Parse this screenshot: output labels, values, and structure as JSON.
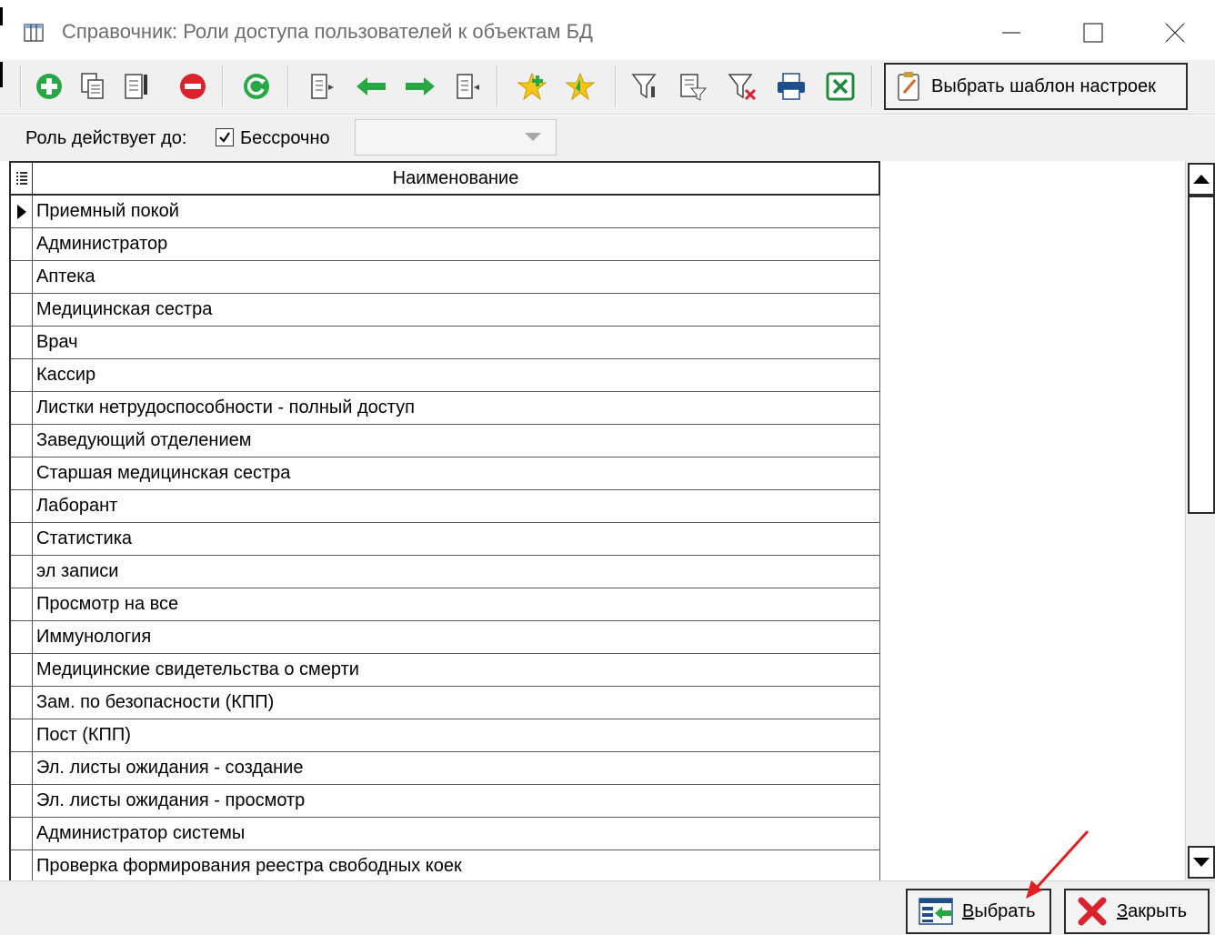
{
  "window": {
    "title": "Справочник: Роли доступа пользователей к объектам БД"
  },
  "toolbar": {
    "icons": [
      "add-icon",
      "copy-icon",
      "edit-icon",
      "delete-icon",
      "refresh-icon",
      "move-left-list-icon",
      "arrow-left-icon",
      "arrow-right-icon",
      "move-right-list-icon",
      "favorite-add-icon",
      "favorite-icon",
      "filter-icon",
      "filter-edit-icon",
      "filter-clear-icon",
      "print-icon",
      "excel-export-icon",
      "template-icon"
    ],
    "template_button_label": "Выбрать шаблон настроек"
  },
  "filter": {
    "role_valid_until_label": "Роль действует до:",
    "indefinite_label": "Бессрочно",
    "indefinite_checked": true,
    "date_value": ""
  },
  "grid": {
    "column_header": "Наименование",
    "selected_index": 0,
    "rows": [
      "Приемный покой",
      "Администратор",
      "Аптека",
      "Медицинская сестра",
      "Врач",
      "Кассир",
      "Листки нетрудоспособности - полный доступ",
      "Заведующий отделением",
      "Старшая медицинская сестра",
      "Лаборант",
      "Статистика",
      "эл записи",
      "Просмотр на все",
      "Иммунология",
      "Медицинские свидетельства о смерти",
      "Зам. по безопасности (КПП)",
      "Пост (КПП)",
      "Эл. листы ожидания - создание",
      "Эл. листы ожидания - просмотр",
      "Администратор системы",
      "Проверка формирования реестра свободных коек"
    ]
  },
  "buttons": {
    "select_label": "Выбрать",
    "close_label": "Закрыть"
  },
  "colors": {
    "toolbar_bg": "#f0f0f0",
    "annotation_arrow": "#e02020",
    "green_icon": "#28a745",
    "red_icon": "#d9232d"
  }
}
